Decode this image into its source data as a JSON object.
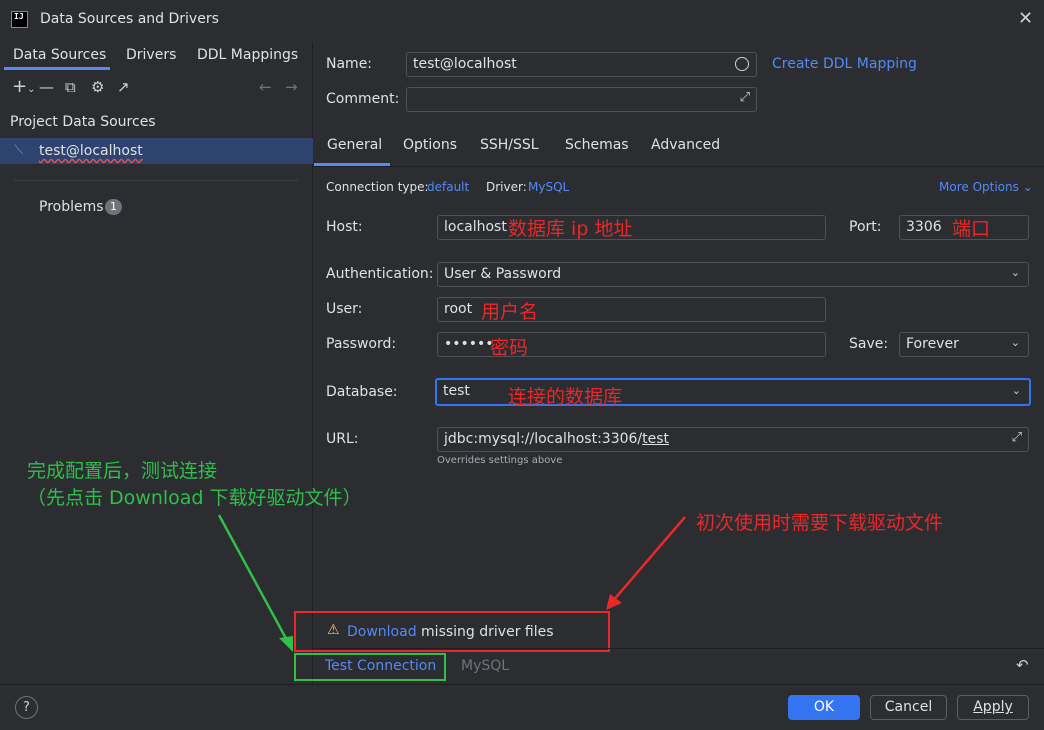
{
  "window": {
    "title": "Data Sources and Drivers",
    "logo": "IJ"
  },
  "left": {
    "tabs": [
      "Data Sources",
      "Drivers",
      "DDL Mappings"
    ],
    "section_title": "Project Data Sources",
    "datasource": "test@localhost",
    "problems_label": "Problems",
    "problems_count": "1"
  },
  "form": {
    "name_label": "Name:",
    "name_value": "test@localhost",
    "create_ddl": "Create DDL Mapping",
    "comment_label": "Comment:",
    "tabs": [
      "General",
      "Options",
      "SSH/SSL",
      "Schemas",
      "Advanced"
    ],
    "conn_type_label": "Connection type:",
    "conn_type_value": "default",
    "driver_label": "Driver:",
    "driver_value": "MySQL",
    "more_options": "More Options",
    "host_label": "Host:",
    "host_value": "localhost",
    "port_label": "Port:",
    "port_value": "3306",
    "auth_label": "Authentication:",
    "auth_value": "User & Password",
    "user_label": "User:",
    "user_value": "root",
    "password_label": "Password:",
    "password_value": "••••••",
    "save_label": "Save:",
    "save_value": "Forever",
    "database_label": "Database:",
    "database_value": "test",
    "url_label": "URL:",
    "url_prefix": "jdbc:mysql://localhost:3306/",
    "url_db": "test",
    "url_hint": "Overrides settings above"
  },
  "annotations": {
    "host_note": "数据库 ip 地址",
    "port_note": "端口",
    "user_note": "用户名",
    "password_note": "密码",
    "database_note": "连接的数据库",
    "green_line1": "完成配置后，测试连接",
    "green_line2": "（先点击 Download 下载好驱动文件）",
    "red_note": "初次使用时需要下载驱动文件"
  },
  "footer": {
    "download_link": "Download",
    "download_rest": " missing driver files",
    "test_connection": "Test Connection",
    "driver_name": "MySQL"
  },
  "buttons": {
    "help": "?",
    "ok": "OK",
    "cancel": "Cancel",
    "apply": "Apply"
  },
  "colors": {
    "accent": "#548af7",
    "annotation_red": "#e8282b",
    "annotation_green": "#2fbf4a",
    "warning": "#f2c55c"
  }
}
